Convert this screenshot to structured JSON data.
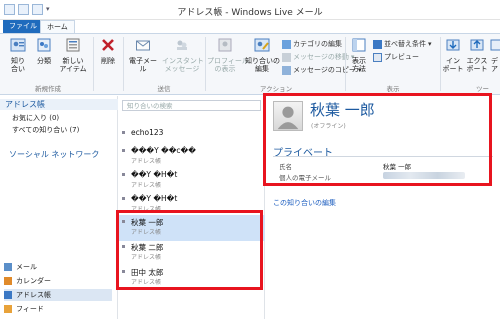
{
  "window": {
    "title": "アドレス帳 - Windows Live メール"
  },
  "tabs": {
    "file": "ファイル",
    "home": "ホーム"
  },
  "ribbon": {
    "new_contact": "知り\n合い",
    "category": "分類",
    "new_item": "新しい\nアイテム",
    "delete": "削除",
    "email": "電子メール",
    "im": "インスタント\nメッセージ",
    "view_profile": "プロフィール\nの表示",
    "edit_contact": "知り合いの\n編集",
    "edit_category": "カテゴリの編集",
    "move_message": "メッセージの移動",
    "copy_message": "メッセージのコピー",
    "sort": "並べ替え条件",
    "preview": "プレビュー",
    "display_method": "表示\n方法",
    "import": "イン\nポート",
    "export": "エクス\nポート",
    "tools_partial": "デ\nア",
    "groups": {
      "new": "新規作成",
      "send": "送信",
      "action": "アクション",
      "view": "表示",
      "tools": "ツー"
    }
  },
  "sidebar": {
    "header": "アドレス帳",
    "favorites": "お気に入り (0)",
    "all_contacts": "すべての知り合い (7)",
    "social": "ソーシャル ネットワーク",
    "nav": [
      {
        "label": "メール"
      },
      {
        "label": "カレンダー"
      },
      {
        "label": "アドレス帳"
      },
      {
        "label": "フィード"
      }
    ]
  },
  "contacts": {
    "search_placeholder": "知り合いの検索",
    "items": [
      {
        "name": "echo123",
        "sub": ""
      },
      {
        "name": "���Y ��c��",
        "sub": "アドレス帳"
      },
      {
        "name": "��Y �H�t",
        "sub": "アドレス帳"
      },
      {
        "name": "��Y �H�t",
        "sub": "アドレス帳"
      },
      {
        "name": "秋葉 一郎",
        "sub": "アドレス帳"
      },
      {
        "name": "秋葉 二郎",
        "sub": "アドレス帳"
      },
      {
        "name": "田中 太郎",
        "sub": "アドレス帳"
      }
    ]
  },
  "detail": {
    "name": "秋葉 一郎",
    "status": "(オフライン)",
    "section": "プライベート",
    "name_label": "氏名",
    "name_value": "秋葉 一郎",
    "email_label": "個人の電子メール",
    "edit_link": "この知り合いの編集"
  },
  "colors": {
    "accent": "#1d5aa0",
    "highlight_box": "#e8141f",
    "file_tab": "#1f6bbd",
    "selection": "#cfe2f8"
  }
}
